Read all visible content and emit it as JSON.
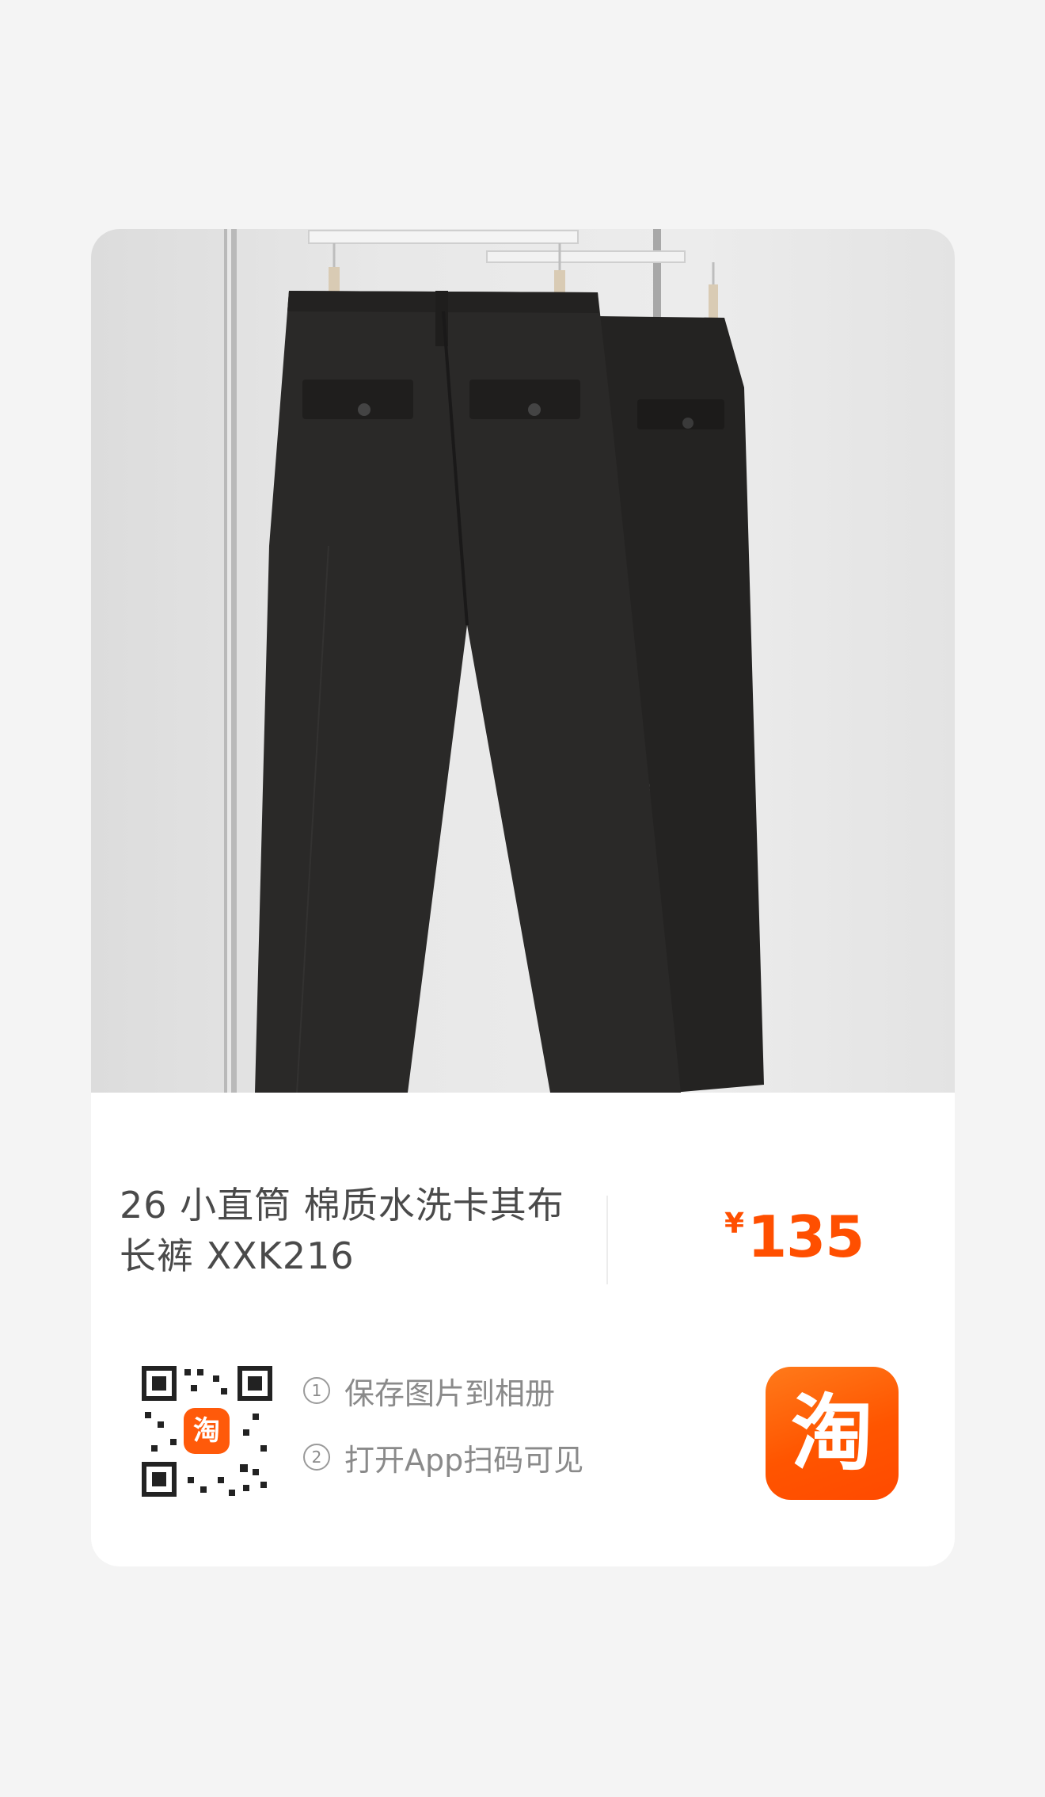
{
  "product": {
    "title": "26 小直筒 棉质水洗卡其布长裤 XXK216",
    "price_symbol": "¥",
    "price": "135"
  },
  "share": {
    "qr_badge_glyph": "淘",
    "steps": [
      {
        "num": "1",
        "text": "保存图片到相册"
      },
      {
        "num": "2",
        "text": "打开App扫码可见"
      }
    ],
    "app_icon_glyph": "淘"
  },
  "colors": {
    "price": "#ff4f00",
    "brand": "#ff5500"
  }
}
